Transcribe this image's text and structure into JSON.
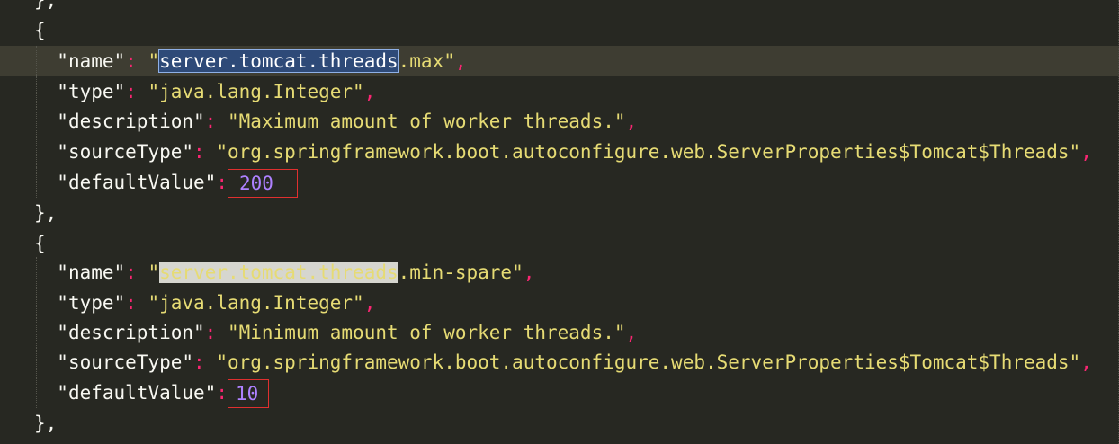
{
  "editor": {
    "lines": {
      "l0": "},",
      "l1": "{",
      "l8": "},",
      "l9": "{",
      "l16": "},"
    },
    "block1": {
      "name_key": "\"name\"",
      "name_quote": "\"",
      "name_selected": "server.tomcat.threads",
      "name_rest": ".max\"",
      "type_key": "\"type\"",
      "type_value": "\"java.lang.Integer\"",
      "description_key": "\"description\"",
      "description_value": "\"Maximum amount of worker threads.\"",
      "sourceType_key": "\"sourceType\"",
      "sourceType_value": "\"org.springframework.boot.autoconfigure.web.ServerProperties$Tomcat$Threads\"",
      "defaultValue_key": "\"defaultValue\"",
      "defaultValue": "200"
    },
    "block2": {
      "name_key": "\"name\"",
      "name_quote": "\"",
      "name_occurrence": "server.tomcat.threads",
      "name_rest": ".min-spare\"",
      "type_key": "\"type\"",
      "type_value": "\"java.lang.Integer\"",
      "description_key": "\"description\"",
      "description_value": "\"Minimum amount of worker threads.\"",
      "sourceType_key": "\"sourceType\"",
      "sourceType_value": "\"org.springframework.boot.autoconfigure.web.ServerProperties$Tomcat$Threads\"",
      "defaultValue_key": "\"defaultValue\"",
      "defaultValue": "10"
    },
    "punct": {
      "colon": ":",
      "comma": ","
    }
  },
  "colors": {
    "background": "#272822",
    "current_line": "#3e3d32",
    "string": "#e6db74",
    "number": "#ae81ff",
    "punctuation": "#f92672",
    "highlight_box": "#e0302f"
  }
}
